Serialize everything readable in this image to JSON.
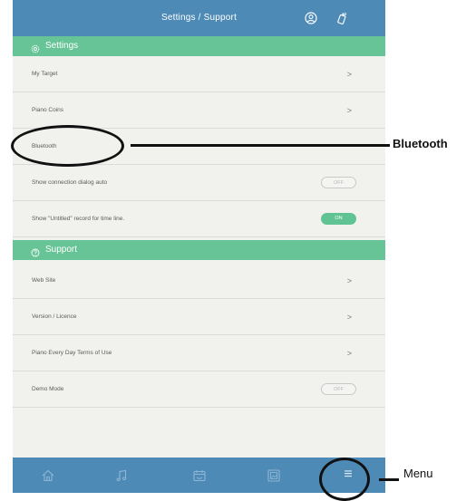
{
  "header": {
    "title": "Settings / Support",
    "account_icon": "account-icon",
    "device_icon": "bluetooth-device-icon"
  },
  "settings_section": {
    "label": "Settings",
    "icon": "gear-icon",
    "rows": [
      {
        "label": "My Target",
        "control": "chevron",
        "value": ">"
      },
      {
        "label": "Piano Coins",
        "control": "chevron",
        "value": ">"
      },
      {
        "label": "Bluetooth",
        "control": "none",
        "value": ""
      },
      {
        "label": "Show connection dialog auto",
        "control": "toggle",
        "value": "OFF"
      },
      {
        "label": "Show \"Untitled\" record for time line.",
        "control": "toggle",
        "value": "ON"
      }
    ]
  },
  "support_section": {
    "label": "Support",
    "icon": "question-circle-icon",
    "rows": [
      {
        "label": "Web Site",
        "control": "chevron",
        "value": ">"
      },
      {
        "label": "Version / Licence",
        "control": "chevron",
        "value": ">"
      },
      {
        "label": "Piano Every Day Terms of Use",
        "control": "chevron",
        "value": ">"
      },
      {
        "label": "Demo Mode",
        "control": "toggle",
        "value": "OFF"
      }
    ]
  },
  "bottom_nav": {
    "items": [
      {
        "icon": "home-icon"
      },
      {
        "icon": "music-note-icon"
      },
      {
        "icon": "calendar-icon"
      },
      {
        "icon": "album-icon"
      },
      {
        "icon": "menu-icon",
        "glyph": "≡"
      }
    ]
  },
  "callouts": {
    "bluetooth": "Bluetooth",
    "menu": "Menu"
  },
  "colors": {
    "header_blue": "#4d8ab6",
    "section_green": "#66c496",
    "toggle_on": "#5fc393",
    "background": "#f1f2ee"
  }
}
